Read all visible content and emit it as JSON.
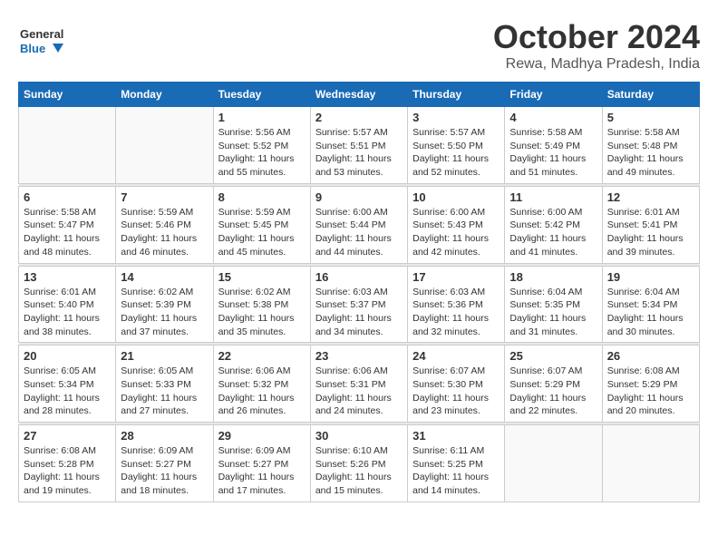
{
  "header": {
    "logo_general": "General",
    "logo_blue": "Blue",
    "title": "October 2024",
    "location": "Rewa, Madhya Pradesh, India"
  },
  "weekdays": [
    "Sunday",
    "Monday",
    "Tuesday",
    "Wednesday",
    "Thursday",
    "Friday",
    "Saturday"
  ],
  "weeks": [
    [
      {
        "day": "",
        "sunrise": "",
        "sunset": "",
        "daylight": ""
      },
      {
        "day": "",
        "sunrise": "",
        "sunset": "",
        "daylight": ""
      },
      {
        "day": "1",
        "sunrise": "Sunrise: 5:56 AM",
        "sunset": "Sunset: 5:52 PM",
        "daylight": "Daylight: 11 hours and 55 minutes."
      },
      {
        "day": "2",
        "sunrise": "Sunrise: 5:57 AM",
        "sunset": "Sunset: 5:51 PM",
        "daylight": "Daylight: 11 hours and 53 minutes."
      },
      {
        "day": "3",
        "sunrise": "Sunrise: 5:57 AM",
        "sunset": "Sunset: 5:50 PM",
        "daylight": "Daylight: 11 hours and 52 minutes."
      },
      {
        "day": "4",
        "sunrise": "Sunrise: 5:58 AM",
        "sunset": "Sunset: 5:49 PM",
        "daylight": "Daylight: 11 hours and 51 minutes."
      },
      {
        "day": "5",
        "sunrise": "Sunrise: 5:58 AM",
        "sunset": "Sunset: 5:48 PM",
        "daylight": "Daylight: 11 hours and 49 minutes."
      }
    ],
    [
      {
        "day": "6",
        "sunrise": "Sunrise: 5:58 AM",
        "sunset": "Sunset: 5:47 PM",
        "daylight": "Daylight: 11 hours and 48 minutes."
      },
      {
        "day": "7",
        "sunrise": "Sunrise: 5:59 AM",
        "sunset": "Sunset: 5:46 PM",
        "daylight": "Daylight: 11 hours and 46 minutes."
      },
      {
        "day": "8",
        "sunrise": "Sunrise: 5:59 AM",
        "sunset": "Sunset: 5:45 PM",
        "daylight": "Daylight: 11 hours and 45 minutes."
      },
      {
        "day": "9",
        "sunrise": "Sunrise: 6:00 AM",
        "sunset": "Sunset: 5:44 PM",
        "daylight": "Daylight: 11 hours and 44 minutes."
      },
      {
        "day": "10",
        "sunrise": "Sunrise: 6:00 AM",
        "sunset": "Sunset: 5:43 PM",
        "daylight": "Daylight: 11 hours and 42 minutes."
      },
      {
        "day": "11",
        "sunrise": "Sunrise: 6:00 AM",
        "sunset": "Sunset: 5:42 PM",
        "daylight": "Daylight: 11 hours and 41 minutes."
      },
      {
        "day": "12",
        "sunrise": "Sunrise: 6:01 AM",
        "sunset": "Sunset: 5:41 PM",
        "daylight": "Daylight: 11 hours and 39 minutes."
      }
    ],
    [
      {
        "day": "13",
        "sunrise": "Sunrise: 6:01 AM",
        "sunset": "Sunset: 5:40 PM",
        "daylight": "Daylight: 11 hours and 38 minutes."
      },
      {
        "day": "14",
        "sunrise": "Sunrise: 6:02 AM",
        "sunset": "Sunset: 5:39 PM",
        "daylight": "Daylight: 11 hours and 37 minutes."
      },
      {
        "day": "15",
        "sunrise": "Sunrise: 6:02 AM",
        "sunset": "Sunset: 5:38 PM",
        "daylight": "Daylight: 11 hours and 35 minutes."
      },
      {
        "day": "16",
        "sunrise": "Sunrise: 6:03 AM",
        "sunset": "Sunset: 5:37 PM",
        "daylight": "Daylight: 11 hours and 34 minutes."
      },
      {
        "day": "17",
        "sunrise": "Sunrise: 6:03 AM",
        "sunset": "Sunset: 5:36 PM",
        "daylight": "Daylight: 11 hours and 32 minutes."
      },
      {
        "day": "18",
        "sunrise": "Sunrise: 6:04 AM",
        "sunset": "Sunset: 5:35 PM",
        "daylight": "Daylight: 11 hours and 31 minutes."
      },
      {
        "day": "19",
        "sunrise": "Sunrise: 6:04 AM",
        "sunset": "Sunset: 5:34 PM",
        "daylight": "Daylight: 11 hours and 30 minutes."
      }
    ],
    [
      {
        "day": "20",
        "sunrise": "Sunrise: 6:05 AM",
        "sunset": "Sunset: 5:34 PM",
        "daylight": "Daylight: 11 hours and 28 minutes."
      },
      {
        "day": "21",
        "sunrise": "Sunrise: 6:05 AM",
        "sunset": "Sunset: 5:33 PM",
        "daylight": "Daylight: 11 hours and 27 minutes."
      },
      {
        "day": "22",
        "sunrise": "Sunrise: 6:06 AM",
        "sunset": "Sunset: 5:32 PM",
        "daylight": "Daylight: 11 hours and 26 minutes."
      },
      {
        "day": "23",
        "sunrise": "Sunrise: 6:06 AM",
        "sunset": "Sunset: 5:31 PM",
        "daylight": "Daylight: 11 hours and 24 minutes."
      },
      {
        "day": "24",
        "sunrise": "Sunrise: 6:07 AM",
        "sunset": "Sunset: 5:30 PM",
        "daylight": "Daylight: 11 hours and 23 minutes."
      },
      {
        "day": "25",
        "sunrise": "Sunrise: 6:07 AM",
        "sunset": "Sunset: 5:29 PM",
        "daylight": "Daylight: 11 hours and 22 minutes."
      },
      {
        "day": "26",
        "sunrise": "Sunrise: 6:08 AM",
        "sunset": "Sunset: 5:29 PM",
        "daylight": "Daylight: 11 hours and 20 minutes."
      }
    ],
    [
      {
        "day": "27",
        "sunrise": "Sunrise: 6:08 AM",
        "sunset": "Sunset: 5:28 PM",
        "daylight": "Daylight: 11 hours and 19 minutes."
      },
      {
        "day": "28",
        "sunrise": "Sunrise: 6:09 AM",
        "sunset": "Sunset: 5:27 PM",
        "daylight": "Daylight: 11 hours and 18 minutes."
      },
      {
        "day": "29",
        "sunrise": "Sunrise: 6:09 AM",
        "sunset": "Sunset: 5:27 PM",
        "daylight": "Daylight: 11 hours and 17 minutes."
      },
      {
        "day": "30",
        "sunrise": "Sunrise: 6:10 AM",
        "sunset": "Sunset: 5:26 PM",
        "daylight": "Daylight: 11 hours and 15 minutes."
      },
      {
        "day": "31",
        "sunrise": "Sunrise: 6:11 AM",
        "sunset": "Sunset: 5:25 PM",
        "daylight": "Daylight: 11 hours and 14 minutes."
      },
      {
        "day": "",
        "sunrise": "",
        "sunset": "",
        "daylight": ""
      },
      {
        "day": "",
        "sunrise": "",
        "sunset": "",
        "daylight": ""
      }
    ]
  ]
}
